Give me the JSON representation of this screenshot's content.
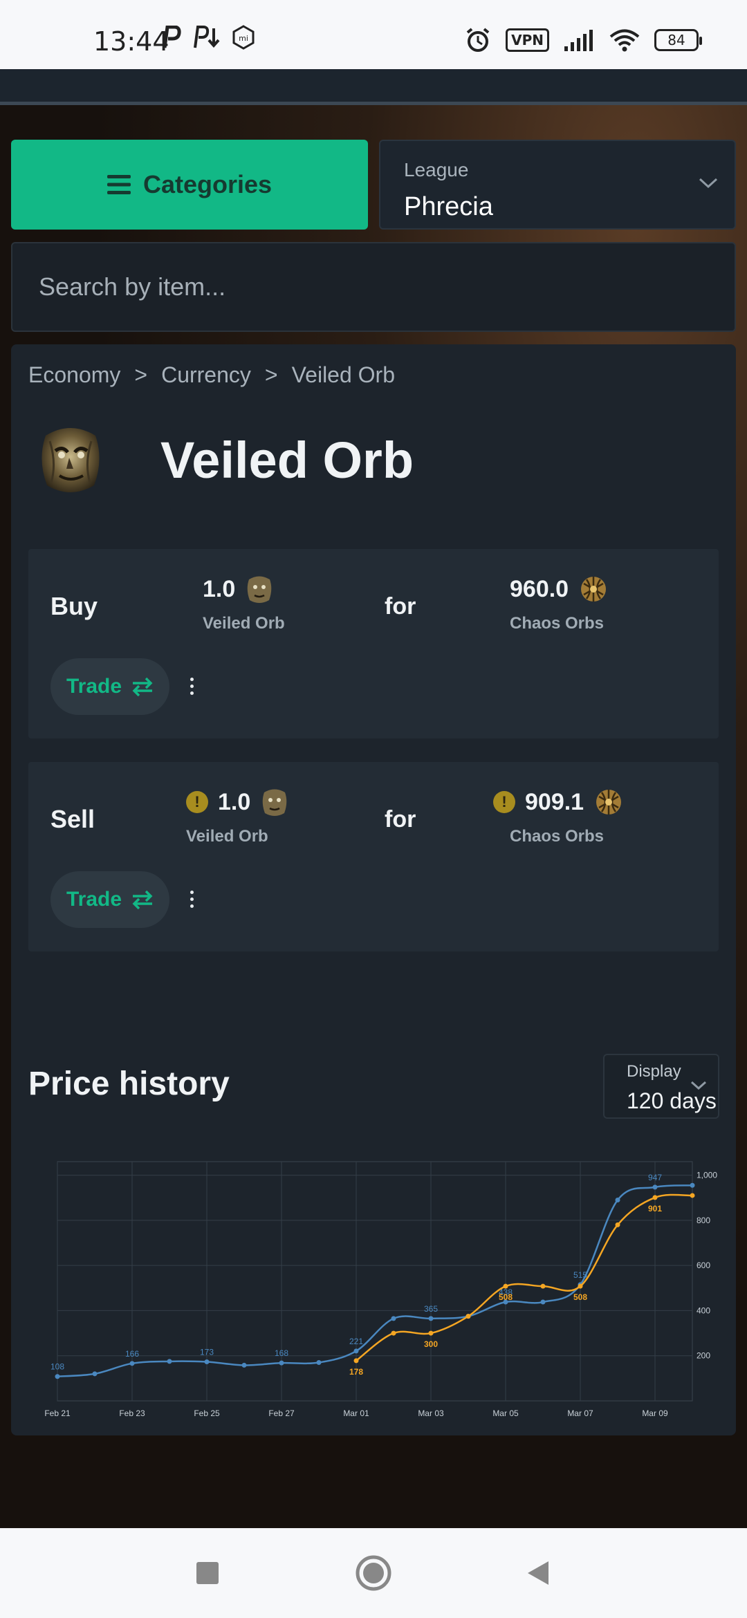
{
  "status_bar": {
    "time": "13:44",
    "vpn": "VPN",
    "battery": "84"
  },
  "controls": {
    "categories_label": "Categories",
    "league_label": "League",
    "league_value": "Phrecia",
    "search_placeholder": "Search by item..."
  },
  "breadcrumb": [
    "Economy",
    "Currency",
    "Veiled Orb"
  ],
  "breadcrumb_sep": ">",
  "item": {
    "title": "Veiled Orb"
  },
  "buy": {
    "label": "Buy",
    "pay_amount": "1.0",
    "pay_name": "Veiled Orb",
    "for_label": "for",
    "get_amount": "960.0",
    "get_name": "Chaos Orbs",
    "trade_label": "Trade"
  },
  "sell": {
    "label": "Sell",
    "pay_amount": "1.0",
    "pay_name": "Veiled Orb",
    "for_label": "for",
    "get_amount": "909.1",
    "get_name": "Chaos Orbs",
    "trade_label": "Trade",
    "warning_glyph": "!"
  },
  "price_history": {
    "title": "Price history",
    "display_label": "Display",
    "display_value": "120 days"
  },
  "colors": {
    "accent": "#12b886",
    "series_blue": "#4a88c0",
    "series_orange": "#f5a623",
    "card": "#1d242c"
  },
  "chart_data": {
    "type": "line",
    "x_ticks": [
      "Feb 21",
      "Feb 23",
      "Feb 25",
      "Feb 27",
      "Mar 01",
      "Mar 03",
      "Mar 05",
      "Mar 07",
      "Mar 09"
    ],
    "y_ticks": [
      "200",
      "400",
      "600",
      "800",
      "1,000"
    ],
    "ylim": [
      0,
      1060
    ],
    "x_range_days": [
      0,
      17
    ],
    "grid": true,
    "series": [
      {
        "color": "#4a88c0",
        "x": [
          0,
          1,
          2,
          3,
          4,
          5,
          6,
          7,
          8,
          9,
          10,
          11,
          12,
          13,
          14,
          15,
          16,
          17
        ],
        "values": [
          108,
          120,
          166,
          175,
          173,
          158,
          168,
          170,
          221,
          365,
          365,
          375,
          438,
          438,
          515,
          890,
          947,
          955
        ],
        "labels": {
          "0": "108",
          "2": "166",
          "4": "173",
          "6": "168",
          "8": "221",
          "10": "365",
          "12": "438",
          "14": "515",
          "16": "947"
        }
      },
      {
        "color": "#f5a623",
        "x": [
          8,
          9,
          10,
          11,
          12,
          13,
          14,
          15,
          16,
          17
        ],
        "values": [
          178,
          300,
          300,
          375,
          508,
          508,
          508,
          780,
          901,
          910
        ],
        "labels": {
          "8": "178",
          "10": "300",
          "12": "508",
          "14": "508",
          "16": "901"
        }
      }
    ]
  }
}
